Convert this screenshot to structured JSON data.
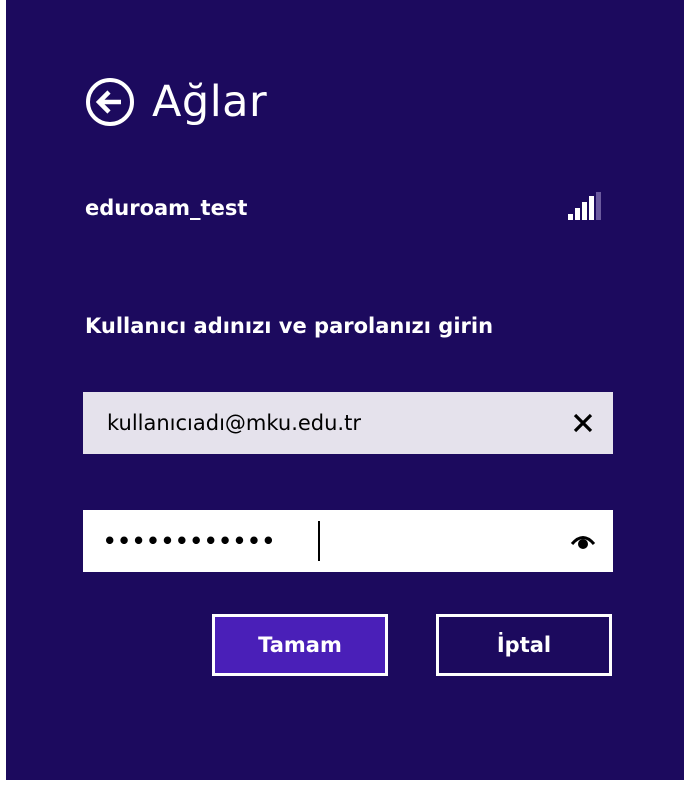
{
  "header": {
    "title": "Ağlar",
    "back_icon": "back-arrow-circle-icon"
  },
  "network": {
    "name": "eduroam_test",
    "signal_icon": "signal-strength-icon",
    "signal_level": 4
  },
  "form": {
    "prompt": "Kullanıcı adınızı ve parolanızı girin",
    "username": {
      "value": "kullanıcıadı@mku.edu.tr",
      "clear_icon": "close-icon"
    },
    "password": {
      "masked_value": "••••••••••••",
      "reveal_icon": "eye-icon"
    }
  },
  "buttons": {
    "ok_label": "Tamam",
    "cancel_label": "İptal"
  },
  "colors": {
    "background": "#1c0a5e",
    "accent": "#4a1fb8"
  }
}
